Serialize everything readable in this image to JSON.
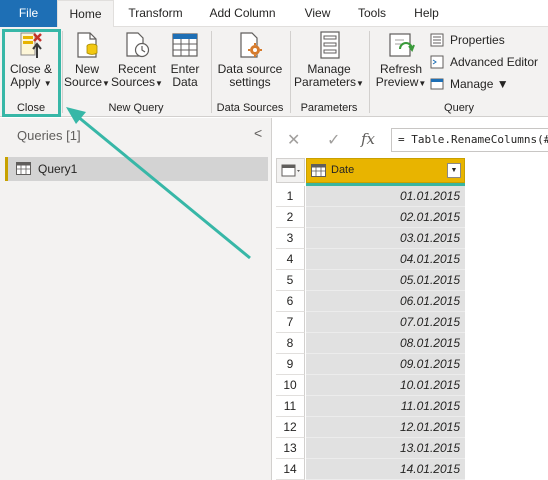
{
  "tabs": [
    "File",
    "Home",
    "Transform",
    "Add Column",
    "View",
    "Tools",
    "Help"
  ],
  "active_tab": "Home",
  "ribbon": {
    "close_apply": {
      "line1": "Close &",
      "line2": "Apply",
      "group": "Close"
    },
    "new_source": {
      "line1": "New",
      "line2": "Source"
    },
    "recent_sources": {
      "line1": "Recent",
      "line2": "Sources"
    },
    "enter_data": {
      "line1": "Enter",
      "line2": "Data"
    },
    "new_query_group": "New Query",
    "data_source_settings": {
      "line1": "Data source",
      "line2": "settings"
    },
    "data_sources_group": "Data Sources",
    "manage_parameters": {
      "line1": "Manage",
      "line2": "Parameters"
    },
    "parameters_group": "Parameters",
    "refresh_preview": {
      "line1": "Refresh",
      "line2": "Preview"
    },
    "properties": "Properties",
    "advanced_editor": "Advanced Editor",
    "manage": "Manage",
    "query_group": "Query"
  },
  "queries_pane": {
    "title": "Queries [1]",
    "collapse_glyph": "<",
    "items": [
      {
        "label": "Query1"
      }
    ]
  },
  "formula_bar": {
    "cancel_glyph": "✕",
    "confirm_glyph": "✓",
    "fx_glyph": "fx",
    "formula": "= Table.RenameColumns(#"
  },
  "grid": {
    "column_header": "Date",
    "rows": [
      {
        "n": "1",
        "v": "01.01.2015"
      },
      {
        "n": "2",
        "v": "02.01.2015"
      },
      {
        "n": "3",
        "v": "03.01.2015"
      },
      {
        "n": "4",
        "v": "04.01.2015"
      },
      {
        "n": "5",
        "v": "05.01.2015"
      },
      {
        "n": "6",
        "v": "06.01.2015"
      },
      {
        "n": "7",
        "v": "07.01.2015"
      },
      {
        "n": "8",
        "v": "08.01.2015"
      },
      {
        "n": "9",
        "v": "09.01.2015"
      },
      {
        "n": "10",
        "v": "10.01.2015"
      },
      {
        "n": "11",
        "v": "11.01.2015"
      },
      {
        "n": "12",
        "v": "12.01.2015"
      },
      {
        "n": "13",
        "v": "13.01.2015"
      },
      {
        "n": "14",
        "v": "14.01.2015"
      }
    ]
  },
  "colors": {
    "file_tab": "#1e6fb5",
    "highlight": "#37b7a7",
    "column_header": "#e8b400"
  }
}
